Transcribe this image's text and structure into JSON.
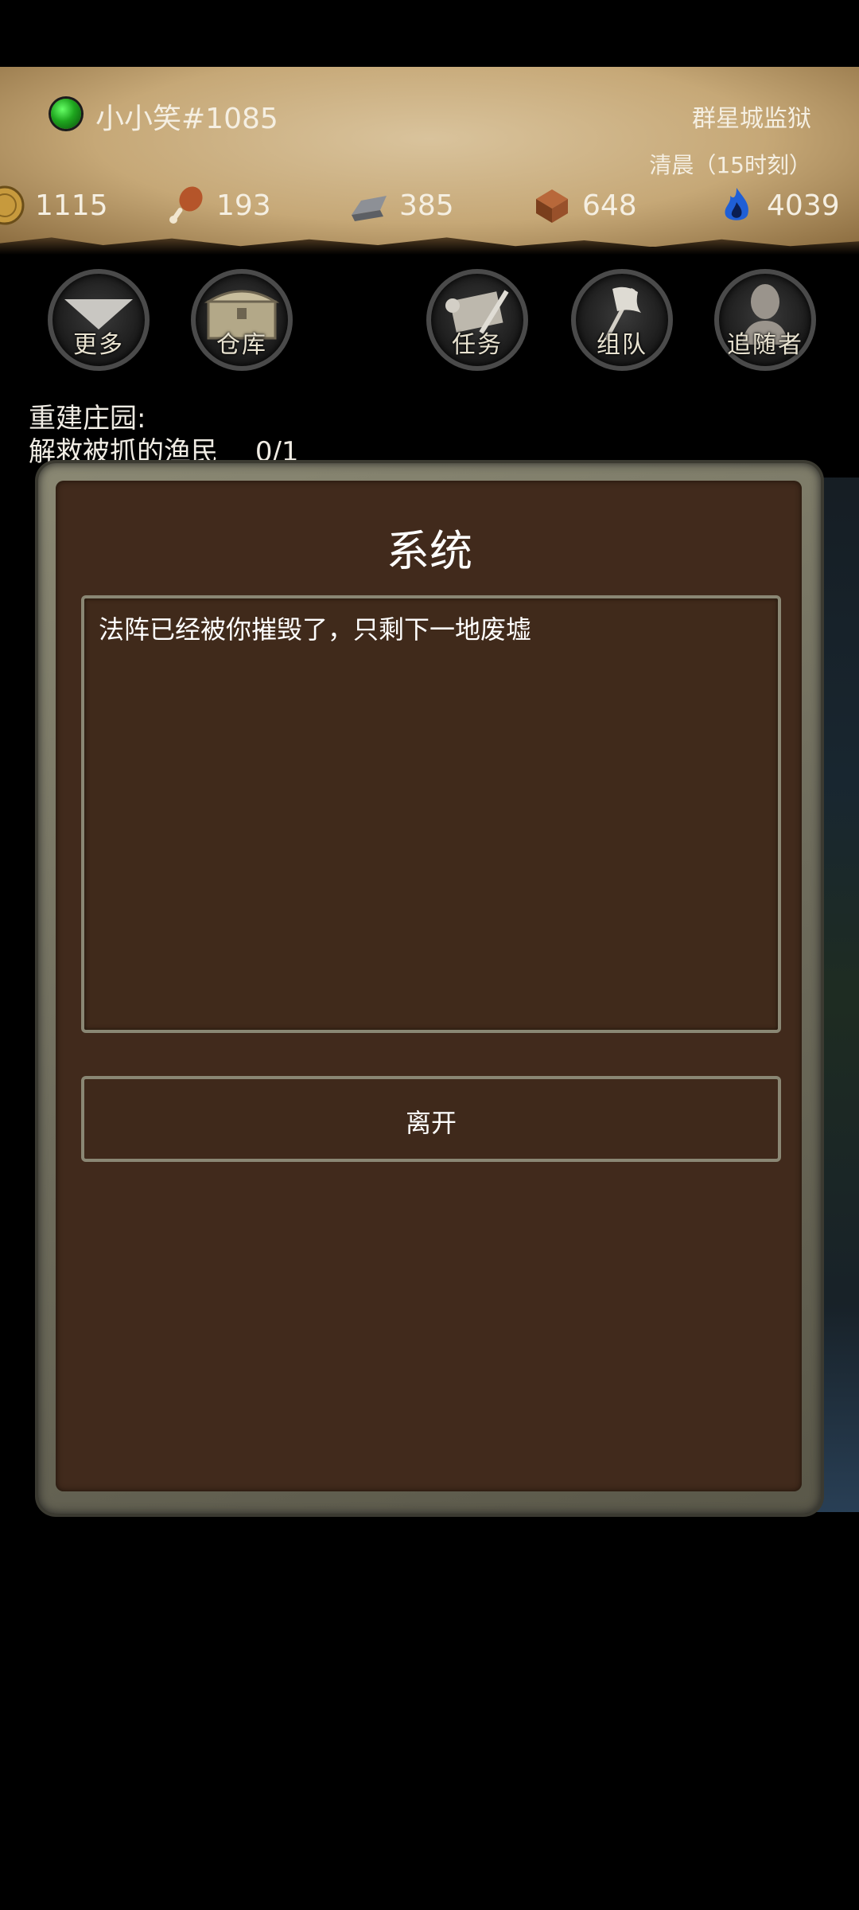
{
  "header": {
    "player_name": "小小笑#1085",
    "location": "群星城监狱",
    "time": "清晨（15时刻）",
    "resources": [
      {
        "icon": "coin-icon",
        "value": "1115"
      },
      {
        "icon": "drumstick-icon",
        "value": "193"
      },
      {
        "icon": "iron-ingot-icon",
        "value": "385"
      },
      {
        "icon": "brick-icon",
        "value": "648"
      },
      {
        "icon": "blue-flame-icon",
        "value": "4039"
      }
    ]
  },
  "nav": {
    "more": "更多",
    "storage": "仓库",
    "quest": "任务",
    "team": "组队",
    "followers": "追随者"
  },
  "quest": {
    "title": "重建庄园:",
    "item": "解救被抓的渔民",
    "progress": "0/1"
  },
  "dialog": {
    "title": "系统",
    "message": "法阵已经被你摧毁了，只剩下一地废墟",
    "leave": "离开"
  },
  "colors": {
    "dialog_bg": "#412a1c",
    "frame": "#8a8774",
    "status": "#1ea51e"
  }
}
